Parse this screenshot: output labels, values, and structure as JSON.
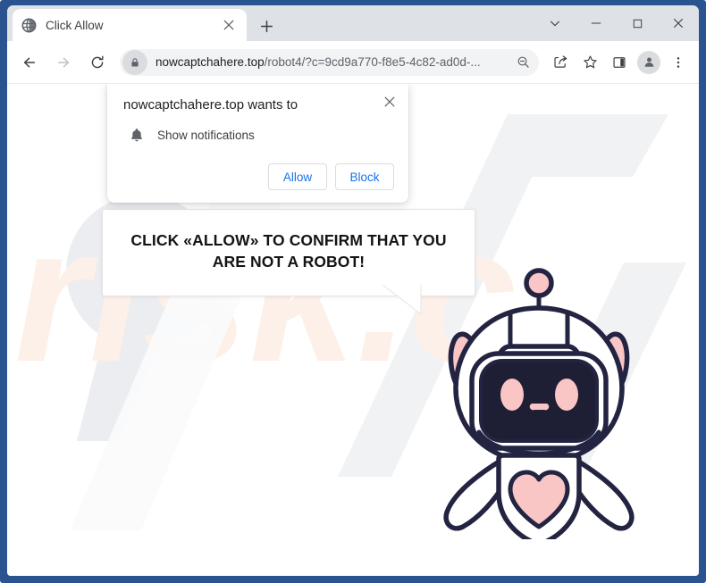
{
  "window": {
    "frame_color": "#2a5490",
    "controls": [
      {
        "name": "tab-search",
        "glyph": "chevron-down"
      },
      {
        "name": "minimize",
        "glyph": "minus"
      },
      {
        "name": "maximize",
        "glyph": "square"
      },
      {
        "name": "close",
        "glyph": "x"
      }
    ]
  },
  "tab": {
    "title": "Click Allow",
    "favicon": "globe-icon",
    "close_label": "Close tab",
    "new_tab_label": "New tab"
  },
  "toolbar": {
    "back_label": "Back",
    "forward_label": "Forward",
    "reload_label": "Reload",
    "omnibox": {
      "host": "nowcaptchahere.top",
      "path": "/robot4/?c=9cd9a770-f8e5-4c82-ad0d-...",
      "full_url": "nowcaptchahere.top/robot4/?c=9cd9a770-f8e5-4c82-ad0d-...",
      "site_info_icon": "lock-icon",
      "zoom_icon": "zoom-out-icon"
    },
    "icons": [
      {
        "name": "share-icon",
        "label": "Share this page"
      },
      {
        "name": "bookmark-star-icon",
        "label": "Bookmark this tab"
      },
      {
        "name": "side-panel-icon",
        "label": "Side panel"
      },
      {
        "name": "profile-avatar-icon",
        "label": "Profile"
      },
      {
        "name": "three-dot-menu-icon",
        "label": "Customize and control Google Chrome"
      }
    ]
  },
  "permission_dialog": {
    "title": "nowcaptchahere.top wants to",
    "permission_icon": "bell-icon",
    "permission_label": "Show notifications",
    "allow_label": "Allow",
    "block_label": "Block",
    "close_label": "Close",
    "allow_text_color": "#1a73e8"
  },
  "page": {
    "speech_bubble": {
      "line1": "CLICK «ALLOW» TO CONFIRM THAT YOU",
      "line2": "ARE NOT A ROBOT!"
    },
    "robot": {
      "name": "robot-mascot",
      "outline_color": "#232342",
      "accent_color": "#f9c5c5",
      "face_color": "#1e1e35",
      "body_color": "#ffffff",
      "shadow_color": "#000000"
    },
    "watermark": {
      "text": "risk.c",
      "gray_color": "#eceef0",
      "peach_color": "#fdf1ea"
    },
    "background_color": "#ffffff"
  }
}
